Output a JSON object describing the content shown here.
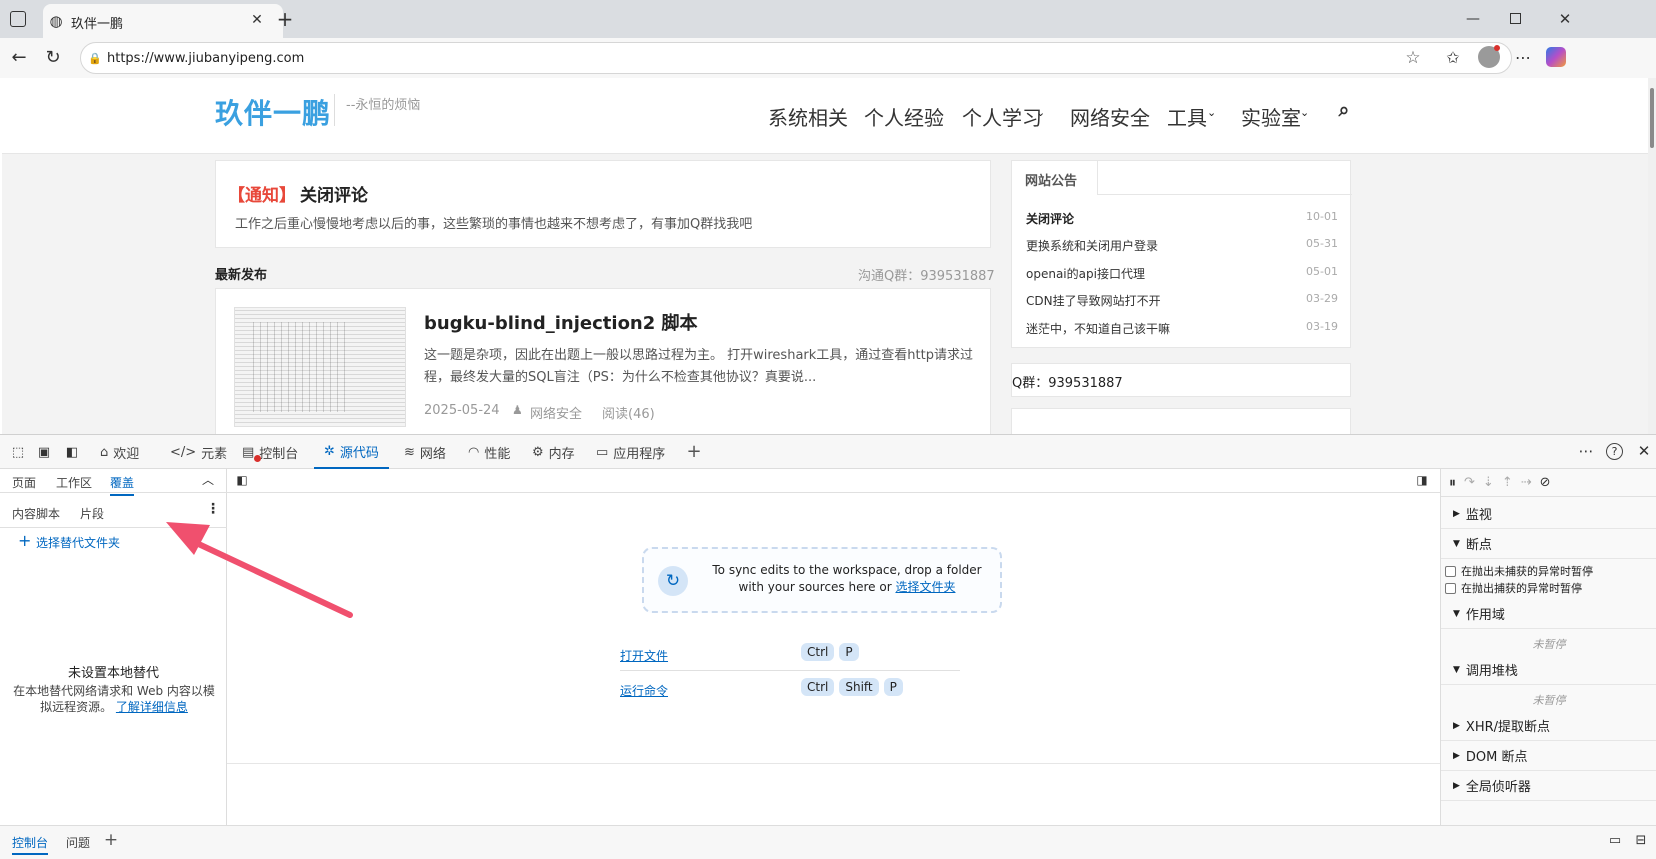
{
  "browser": {
    "tab_title": "玖伴一鹏",
    "url": "https://www.jiubanyipeng.com"
  },
  "site": {
    "logo": "玖伴一鹏",
    "slogan": "--永恒的烦恼",
    "nav": [
      {
        "label": "系统相关"
      },
      {
        "label": "个人经验"
      },
      {
        "label": "个人学习"
      },
      {
        "label": "网络安全"
      },
      {
        "label": "工具"
      },
      {
        "label": "实验室"
      }
    ],
    "notice": {
      "tag": "【通知】",
      "title": "关闭评论",
      "text": "工作之后重心慢慢地考虑以后的事，这些繁琐的事情也越来不想考虑了，有事加Q群找我吧"
    },
    "latest_title": "最新发布",
    "qq_group": "沟通Q群：939531887",
    "post": {
      "title": "bugku-blind_injection2 脚本",
      "excerpt": "这一题是杂项，因此在出题上一般以思路过程为主。 打开wireshark工具，通过查看http请求过程，最终发大量的SQL盲注（PS：为什么不检查其他协议？真要说...",
      "date": "2025-05-24",
      "category": "网络安全",
      "reads": "阅读(46)"
    },
    "announce_title": "网站公告",
    "announcements": [
      {
        "title": "关闭评论",
        "date": "10-01"
      },
      {
        "title": "更换系统和关闭用户登录",
        "date": "05-31"
      },
      {
        "title": "openai的api接口代理",
        "date": "05-01"
      },
      {
        "title": "CDN挂了导致网站打不开",
        "date": "03-29"
      },
      {
        "title": "迷茫中，不知道自己该干嘛",
        "date": "03-19"
      }
    ],
    "qq_box": "Q群：939531887"
  },
  "devtools": {
    "tabs": [
      {
        "label": "欢迎"
      },
      {
        "label": "元素"
      },
      {
        "label": "控制台"
      },
      {
        "label": "源代码"
      },
      {
        "label": "网络"
      },
      {
        "label": "性能"
      },
      {
        "label": "内存"
      },
      {
        "label": "应用程序"
      }
    ],
    "left_tabs": [
      "页面",
      "工作区",
      "覆盖"
    ],
    "left_sub_tabs": [
      "内容脚本",
      "片段"
    ],
    "select_folder": "选择替代文件夹",
    "empty_title": "未设置本地替代",
    "empty_desc": "在本地替代网络请求和 Web 内容以模拟远程资源。",
    "learn_more": "了解详细信息",
    "sync_text": "To sync edits to the workspace, drop a folder with your sources here or",
    "sync_link": "选择文件夹",
    "shortcuts": [
      {
        "label": "打开文件",
        "keys": [
          "Ctrl",
          "P"
        ]
      },
      {
        "label": "运行命令",
        "keys": [
          "Ctrl",
          "Shift",
          "P"
        ]
      }
    ],
    "right": {
      "watch": "监视",
      "breakpoints": "断点",
      "pause_uncaught": "在抛出未捕获的异常时暂停",
      "pause_caught": "在抛出捕获的异常时暂停",
      "scope": "作用域",
      "not_paused": "未暂停",
      "callstack": "调用堆栈",
      "not_paused2": "未暂停",
      "xhr": "XHR/提取断点",
      "dom": "DOM 断点",
      "global": "全局侦听器"
    },
    "drawer_tabs": [
      "控制台",
      "问题"
    ]
  },
  "colors": {
    "accent": "#0067c0",
    "logo": "#3aa0e0",
    "notice_tag": "#e8483a",
    "arrow": "#f0506e"
  }
}
